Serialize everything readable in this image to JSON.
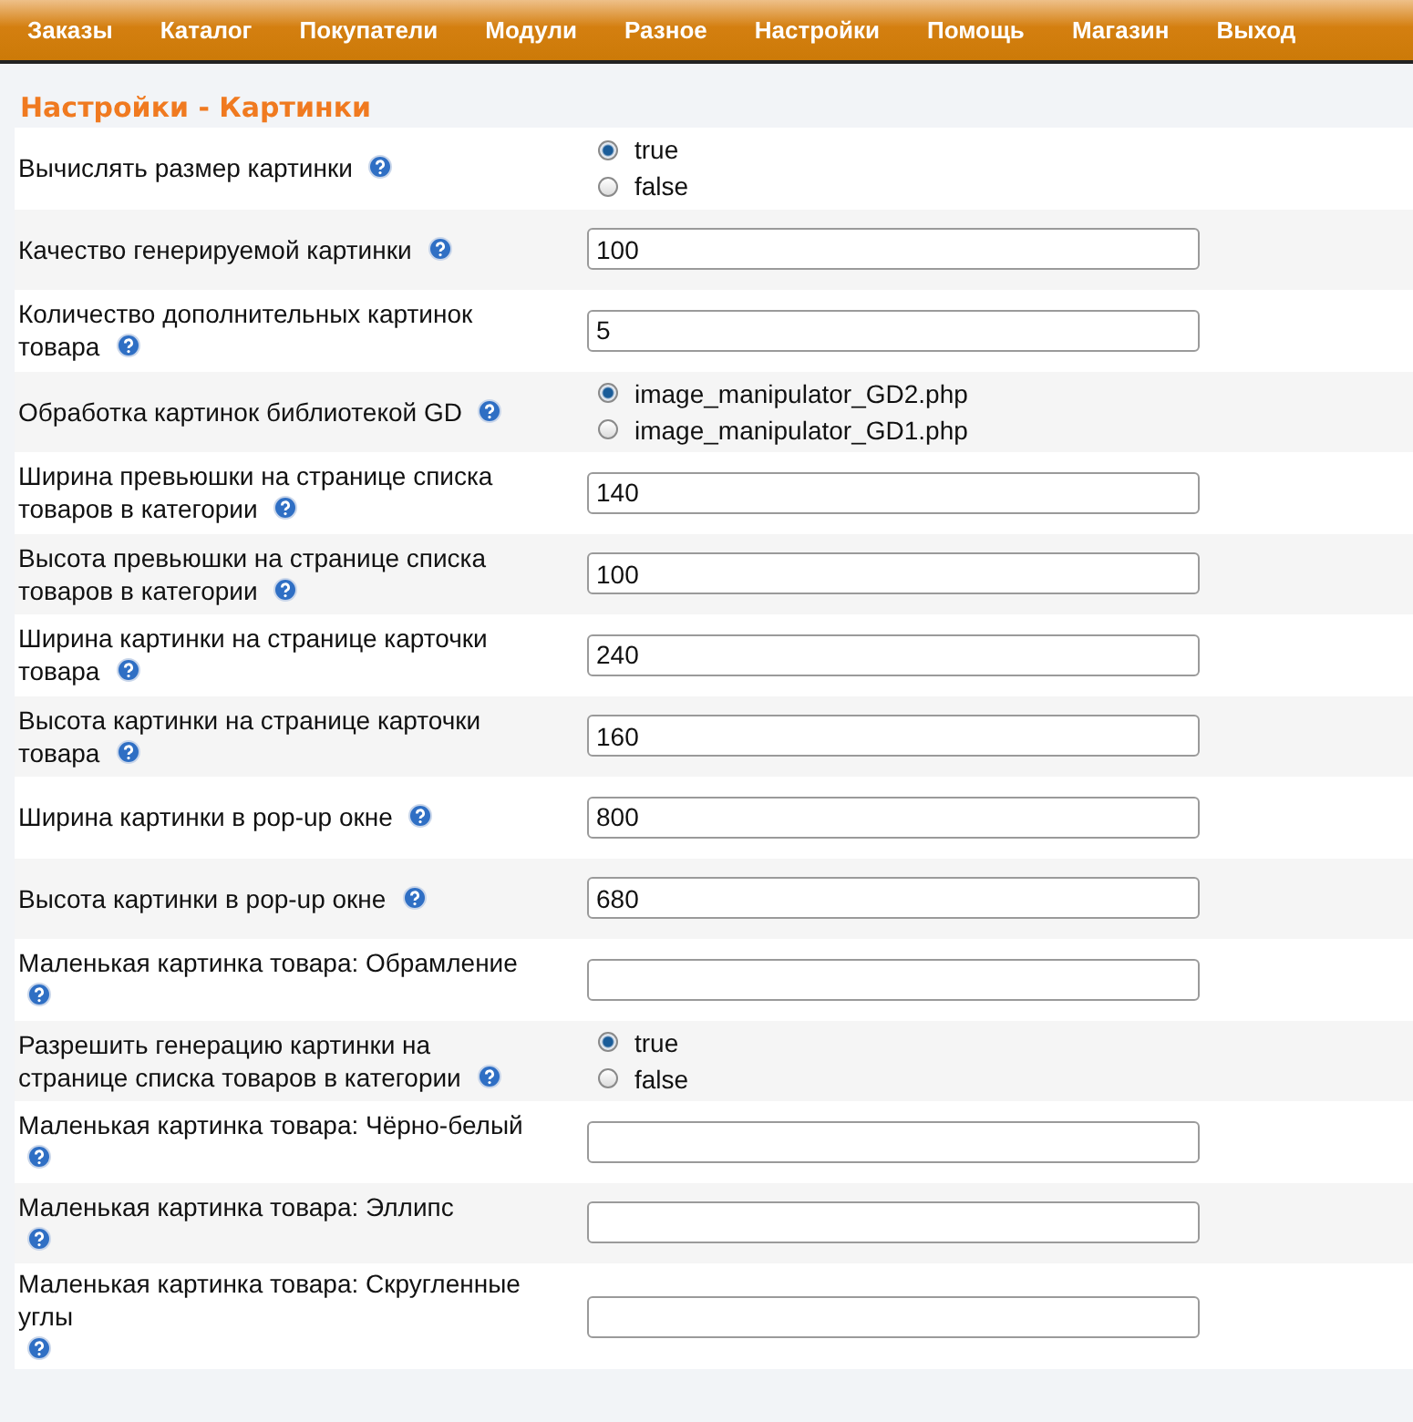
{
  "nav": [
    {
      "label": "Заказы"
    },
    {
      "label": "Каталог"
    },
    {
      "label": "Покупатели"
    },
    {
      "label": "Модули"
    },
    {
      "label": "Разное"
    },
    {
      "label": "Настройки"
    },
    {
      "label": "Помощь"
    },
    {
      "label": "Магазин"
    },
    {
      "label": "Выход"
    }
  ],
  "title": "Настройки - Картинки",
  "rows": [
    {
      "kind": "radio",
      "label": [
        "Вычислять размер картинки"
      ],
      "options": [
        {
          "label": "true",
          "selected": true
        },
        {
          "label": "false",
          "selected": false
        }
      ]
    },
    {
      "kind": "text",
      "label": [
        "Качество генерируемой картинки"
      ],
      "value": "100"
    },
    {
      "kind": "text",
      "label": [
        "Количество дополнительных картинок",
        "товара"
      ],
      "value": "5"
    },
    {
      "kind": "radio",
      "label": [
        "Обработка картинок библиотекой GD"
      ],
      "options": [
        {
          "label": "image_manipulator_GD2.php",
          "selected": true
        },
        {
          "label": "image_manipulator_GD1.php",
          "selected": false
        }
      ]
    },
    {
      "kind": "text",
      "label": [
        "Ширина превьюшки на странице списка",
        "товаров в категории"
      ],
      "value": "140"
    },
    {
      "kind": "text",
      "label": [
        "Высота превьюшки на странице списка",
        "товаров в категории"
      ],
      "value": "100"
    },
    {
      "kind": "text",
      "label": [
        "Ширина картинки на странице карточки",
        "товара"
      ],
      "value": "240"
    },
    {
      "kind": "text",
      "label": [
        "Высота картинки на странице карточки",
        "товара"
      ],
      "value": "160"
    },
    {
      "kind": "text",
      "label": [
        "Ширина картинки в pop-up окне"
      ],
      "value": "800"
    },
    {
      "kind": "text",
      "label": [
        "Высота картинки в pop-up окне"
      ],
      "value": "680"
    },
    {
      "kind": "text",
      "label": [
        "Маленькая картинка товара: Обрамление"
      ],
      "help_below": true
    },
    {
      "kind": "radio",
      "label": [
        "Разрешить генерацию картинки на",
        "странице списка товаров в категории"
      ],
      "options": [
        {
          "label": "true",
          "selected": true
        },
        {
          "label": "false",
          "selected": false
        }
      ]
    },
    {
      "kind": "text",
      "label": [
        "Маленькая картинка товара: Чёрно-белый"
      ],
      "help_below": true
    },
    {
      "kind": "text",
      "label": [
        "Маленькая картинка товара: Эллипс"
      ],
      "help_below": true
    },
    {
      "kind": "text",
      "label": [
        "Маленькая картинка товара: Скругленные",
        "углы"
      ],
      "help_below": true
    }
  ]
}
